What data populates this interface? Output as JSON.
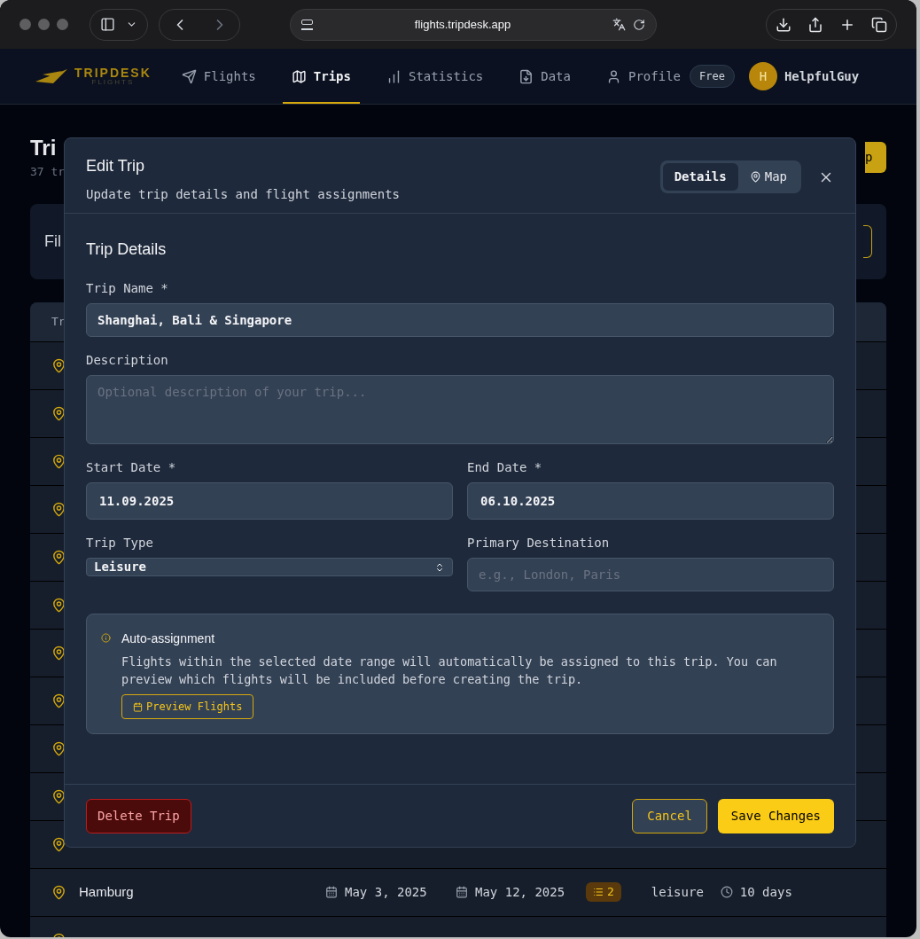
{
  "browser": {
    "url": "flights.tripdesk.app"
  },
  "nav": {
    "logo": "TRIPDESK",
    "logo_sub": "FLIGHTS",
    "items": [
      {
        "label": "Flights",
        "selected": false
      },
      {
        "label": "Trips",
        "selected": true
      },
      {
        "label": "Statistics",
        "selected": false
      },
      {
        "label": "Data",
        "selected": false
      },
      {
        "label": "Profile",
        "selected": false
      }
    ],
    "plan_badge": "Free",
    "user": {
      "initial": "H",
      "name": "HelpfulGuy"
    }
  },
  "page": {
    "title": "Tri",
    "subtitle": "37 tr",
    "new_button": "p",
    "filter_title": "Fil",
    "table_header": "Tr",
    "rows": [
      {
        "kind": "covered"
      },
      {
        "kind": "covered"
      },
      {
        "kind": "covered"
      },
      {
        "kind": "covered"
      },
      {
        "kind": "covered"
      },
      {
        "kind": "covered"
      },
      {
        "kind": "covered"
      },
      {
        "kind": "covered"
      },
      {
        "kind": "covered"
      },
      {
        "kind": "covered"
      },
      {
        "kind": "covered"
      },
      {
        "kind": "full",
        "name": "Hamburg",
        "start": "May 3, 2025",
        "end": "May 12, 2025",
        "flights": "2",
        "type": "leisure",
        "duration": "10 days"
      },
      {
        "kind": "cut"
      }
    ]
  },
  "modal": {
    "title": "Edit Trip",
    "subtitle": "Update trip details and flight assignments",
    "tabs": [
      {
        "label": "Details",
        "selected": true
      },
      {
        "label": "Map",
        "selected": false
      }
    ],
    "section_title": "Trip Details",
    "trip_name": {
      "label": "Trip Name *",
      "value": "Shanghai, Bali & Singapore"
    },
    "description": {
      "label": "Description",
      "placeholder": "Optional description of your trip..."
    },
    "start_date": {
      "label": "Start Date *",
      "value": "11.09.2025"
    },
    "end_date": {
      "label": "End Date *",
      "value": "06.10.2025"
    },
    "trip_type": {
      "label": "Trip Type",
      "value": "Leisure"
    },
    "destination": {
      "label": "Primary Destination",
      "placeholder": "e.g., London, Paris"
    },
    "info": {
      "title": "Auto-assignment",
      "text": "Flights within the selected date range will automatically be assigned to this trip. You can preview which flights will be included before creating the trip.",
      "button": "Preview Flights"
    },
    "delete_button": "Delete Trip",
    "cancel_button": "Cancel",
    "save_button": "Save Changes"
  }
}
